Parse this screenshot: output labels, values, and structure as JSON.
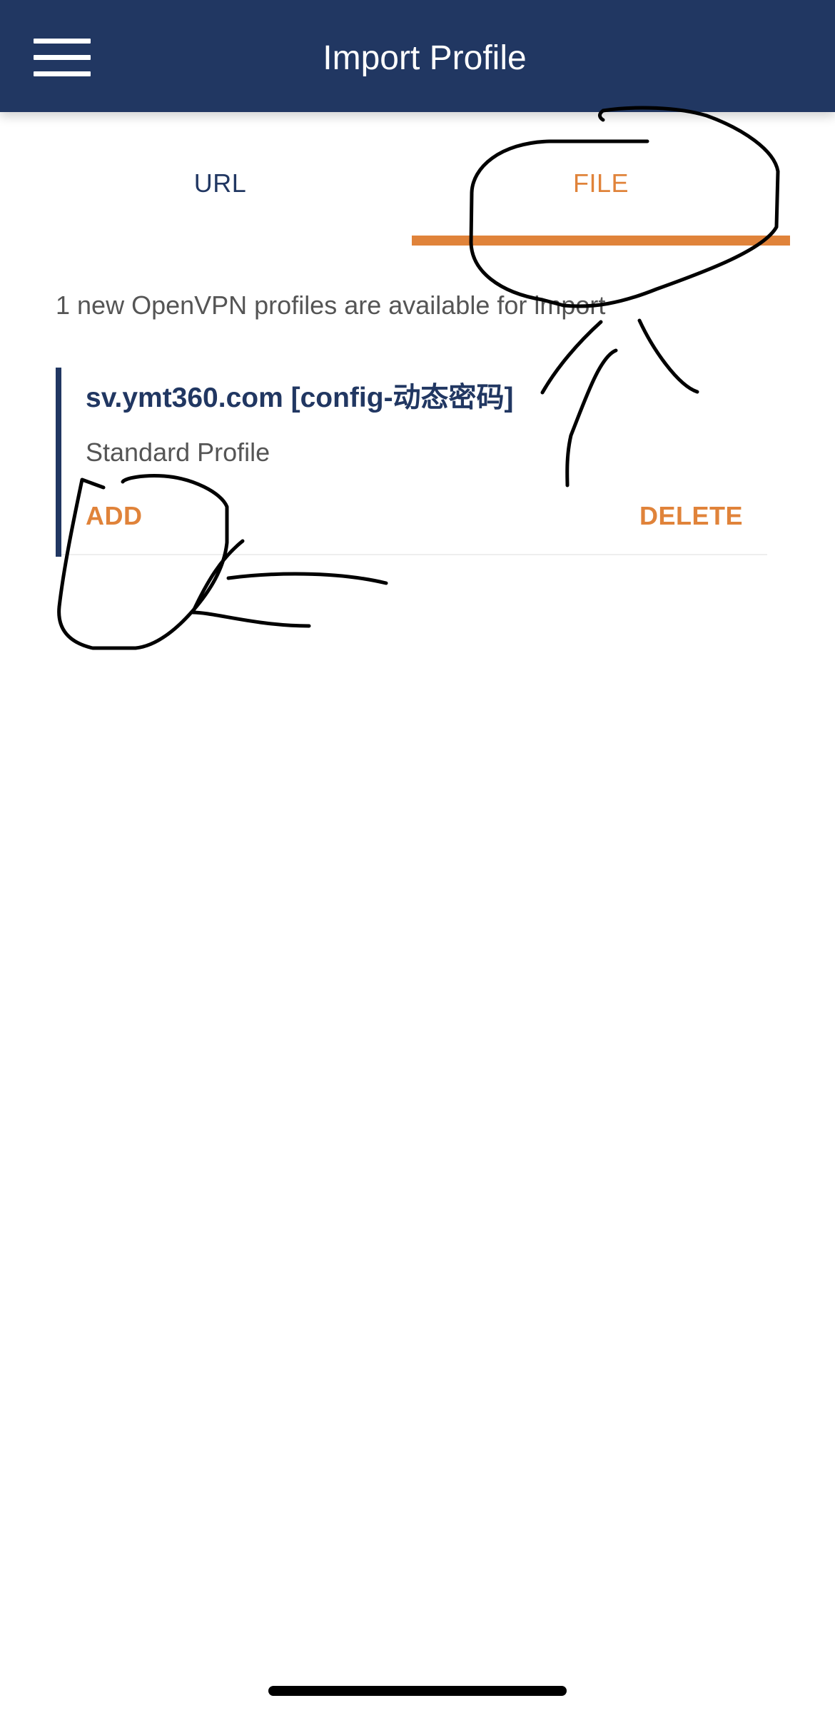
{
  "header": {
    "title": "Import Profile",
    "menu_icon": "hamburger-menu-icon",
    "background": "#213762"
  },
  "tabs": [
    {
      "label": "URL",
      "selected": false
    },
    {
      "label": "FILE",
      "selected": true
    }
  ],
  "accent_color": "#e0833a",
  "content": {
    "info": "1 new OpenVPN profiles are available for import",
    "profile": {
      "name": "sv.ymt360.com [config-动态密码]",
      "type": "Standard Profile",
      "add_label": "ADD",
      "delete_label": "DELETE"
    }
  }
}
